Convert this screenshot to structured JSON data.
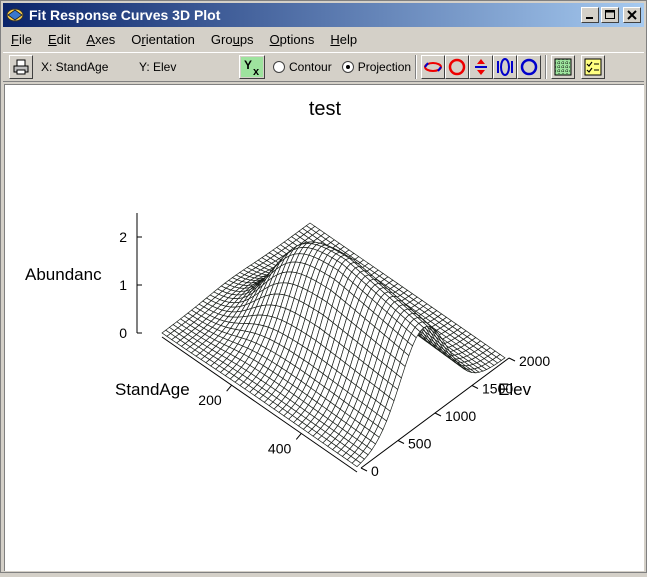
{
  "window": {
    "title": "Fit Response Curves 3D Plot"
  },
  "menu": [
    {
      "pre": "",
      "acc": "F",
      "post": "ile"
    },
    {
      "pre": "",
      "acc": "E",
      "post": "dit"
    },
    {
      "pre": "",
      "acc": "A",
      "post": "xes"
    },
    {
      "pre": "O",
      "acc": "r",
      "post": "ientation"
    },
    {
      "pre": "Gro",
      "acc": "u",
      "post": "ps"
    },
    {
      "pre": "",
      "acc": "O",
      "post": "ptions"
    },
    {
      "pre": "",
      "acc": "H",
      "post": "elp"
    }
  ],
  "toolbar": {
    "x_var": "X: StandAge",
    "y_var": "Y: Elev",
    "swap_label": "Yx",
    "mode_contour": "Contour",
    "mode_projection": "Projection",
    "selected_mode": "Projection"
  },
  "chart_data": {
    "type": "surface",
    "title": "test",
    "xlabel": "StandAge",
    "ylabel": "Elev",
    "zlabel": "Abundanc",
    "x_ticks": [
      "200",
      "400"
    ],
    "y_ticks": [
      "0",
      "500",
      "1000",
      "1500",
      "2000"
    ],
    "z_ticks": [
      "0",
      "1",
      "2"
    ],
    "xlim": [
      0,
      560
    ],
    "ylim": [
      0,
      2000
    ],
    "zlim": [
      0,
      2.5
    ],
    "surface_peak": 2.2,
    "grid_resolution": 40,
    "mesh_color": "#1a1f1a"
  }
}
